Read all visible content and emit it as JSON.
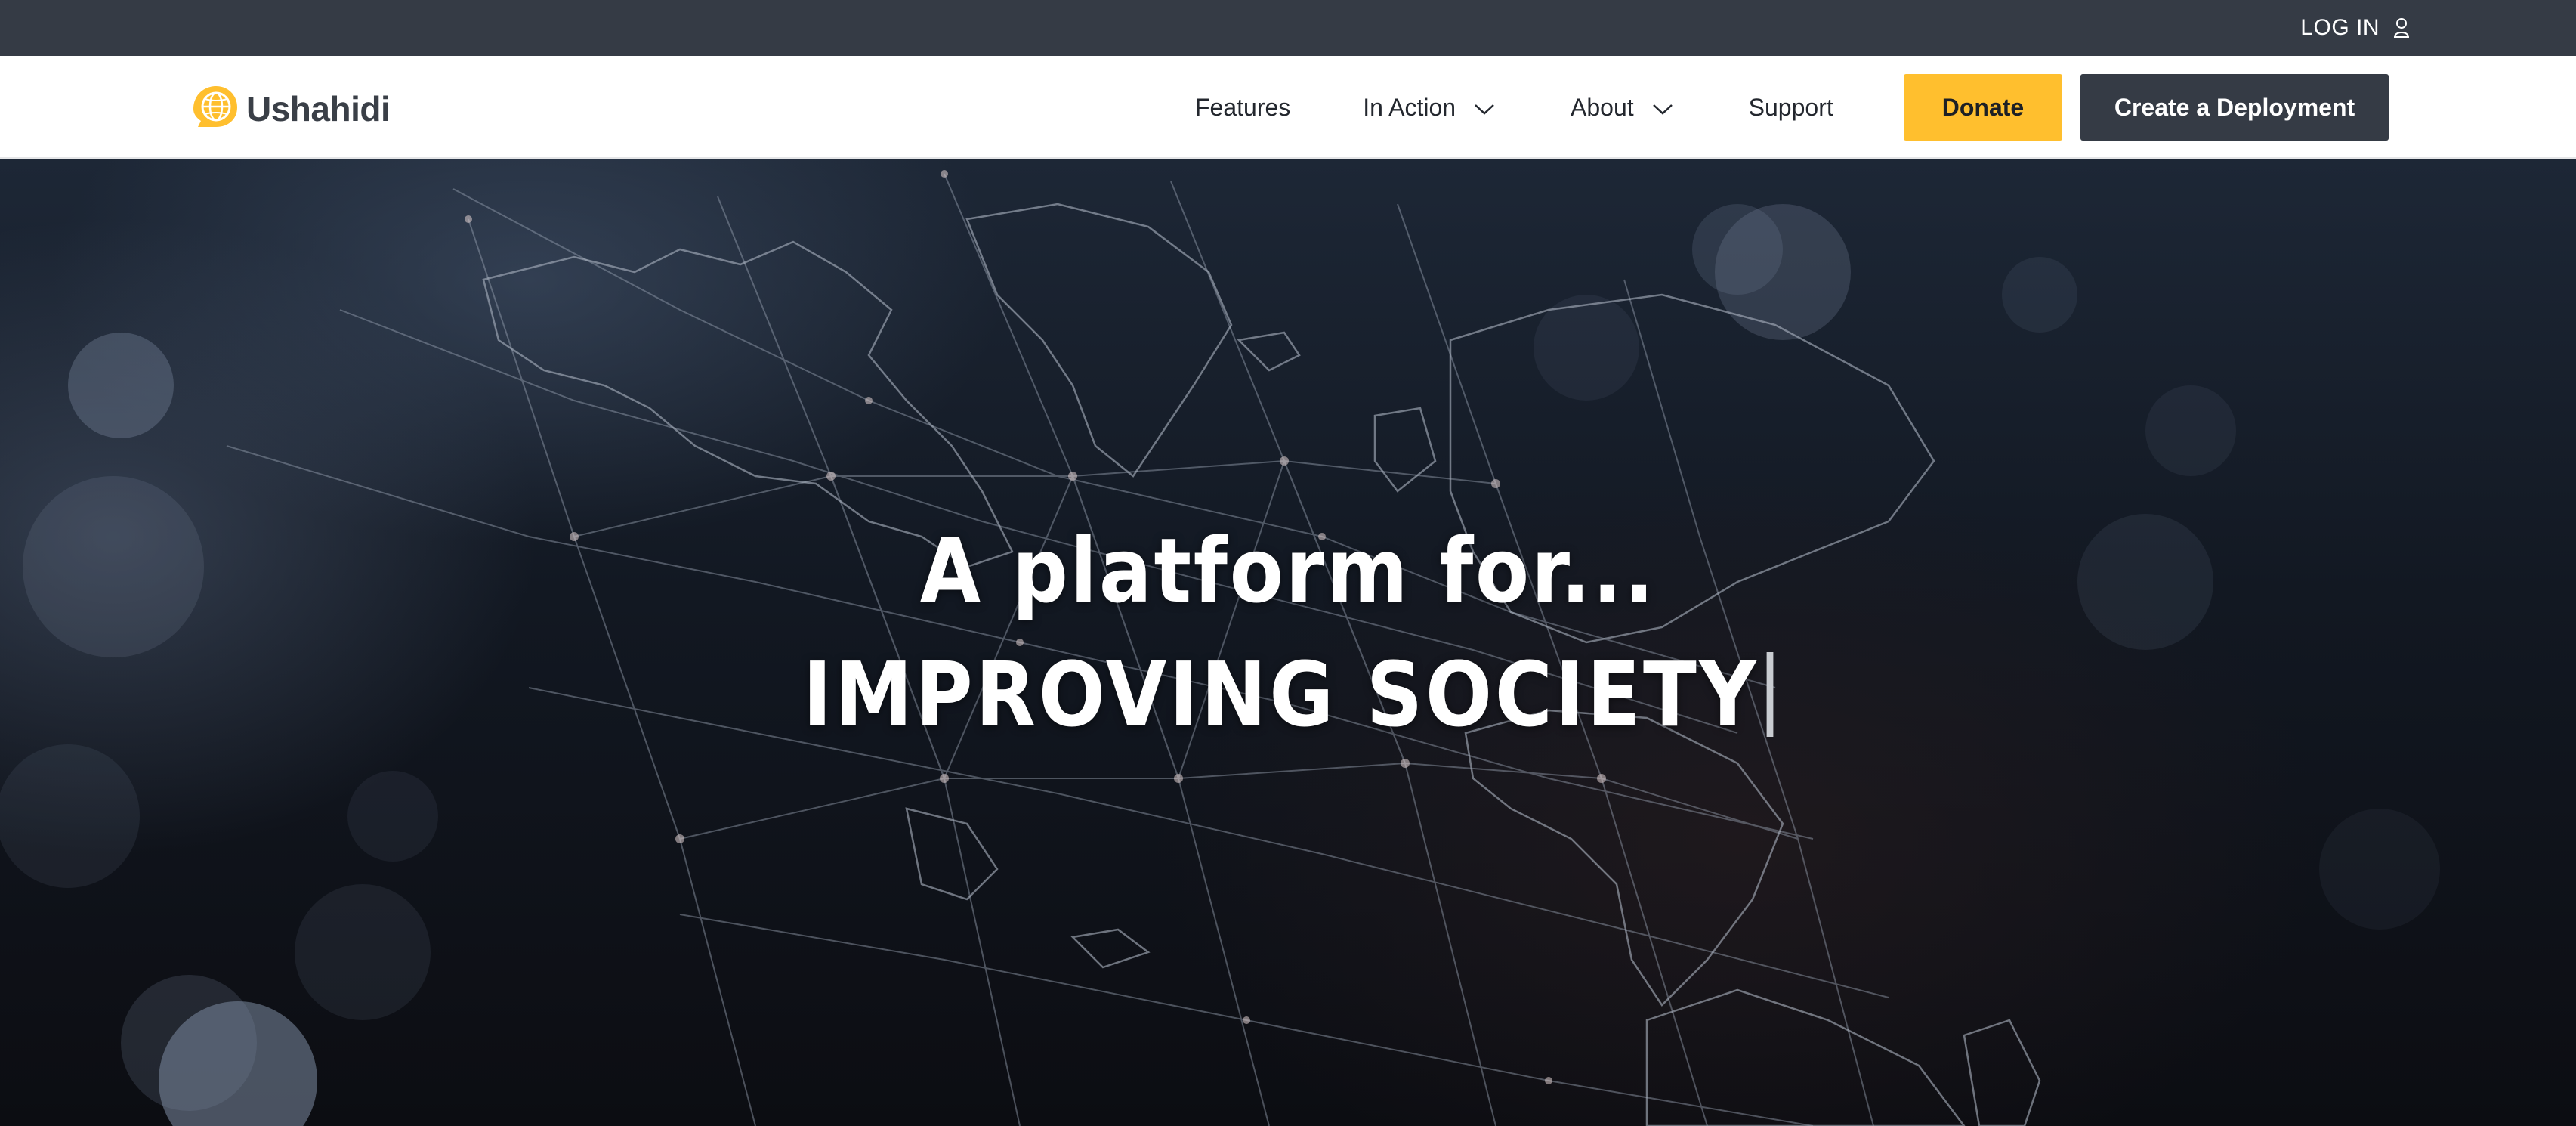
{
  "topbar": {
    "login_label": "LOG IN",
    "login_icon": "user-icon"
  },
  "brand": {
    "name": "Ushahidi",
    "logo_icon": "globe-logo-icon",
    "logo_color": "#ffbf2e"
  },
  "nav": {
    "items": [
      {
        "label": "Features",
        "has_dropdown": false
      },
      {
        "label": "In Action",
        "has_dropdown": true
      },
      {
        "label": "About",
        "has_dropdown": true
      },
      {
        "label": "Support",
        "has_dropdown": false
      }
    ],
    "donate_label": "Donate",
    "deploy_label": "Create a Deployment"
  },
  "hero": {
    "title": "A platform for...",
    "subtitle": "IMPROVING SOCIETY"
  },
  "colors": {
    "topbar_bg": "#353b45",
    "accent_yellow": "#ffbf2e",
    "dark_button": "#353b45",
    "hero_text": "#ffffff"
  }
}
